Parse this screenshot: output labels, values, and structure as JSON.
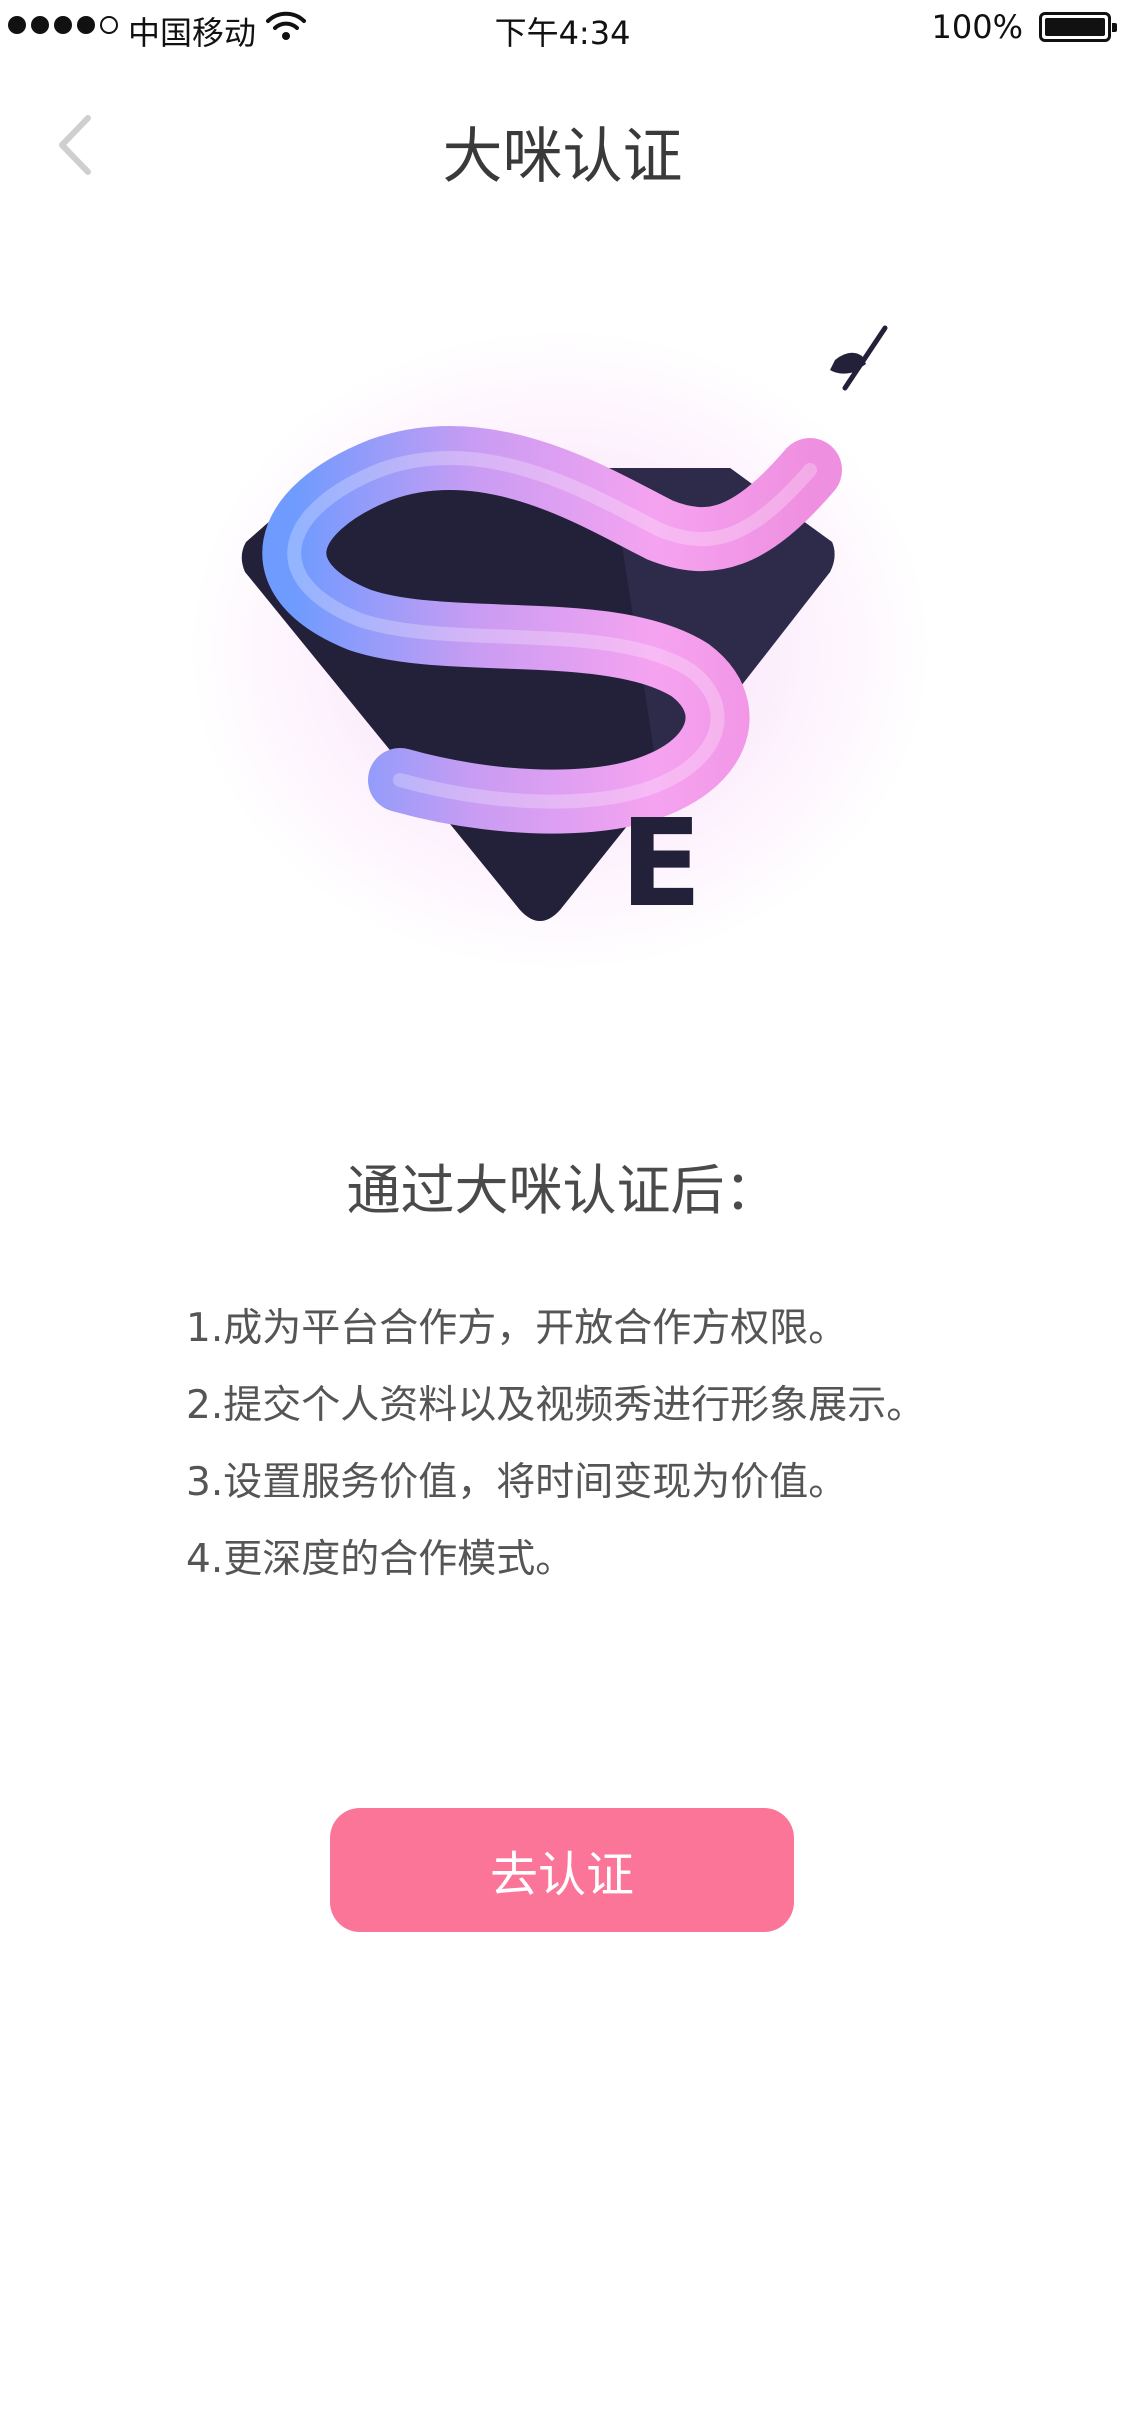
{
  "status_bar": {
    "carrier": "中国移动",
    "time": "下午4:34",
    "battery": "100%"
  },
  "nav": {
    "title": "大咪认证",
    "back_icon": "chevron-left-icon"
  },
  "logo": {
    "letter": "E",
    "icon": "superhero-s-logo-icon"
  },
  "benefits": {
    "title": "通过大咪认证后：",
    "items": [
      "1.成为平台合作方，开放合作方权限。",
      "2.提交个人资料以及视频秀进行形象展示。",
      "3.设置服务价值，将时间变现为价值。",
      "4.更深度的合作模式。"
    ]
  },
  "actions": {
    "certify_label": "去认证"
  },
  "colors": {
    "accent": "#fb7599",
    "logo_dark": "#23203a",
    "logo_pink": "#f5a3f0",
    "logo_blue": "#6f9bff"
  }
}
